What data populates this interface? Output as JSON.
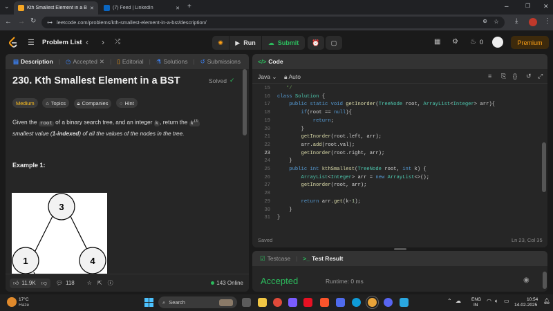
{
  "browser": {
    "tabs": [
      {
        "title": "Kth Smallest Element in a BST",
        "active": true
      },
      {
        "title": "(7) Feed | LinkedIn",
        "active": false
      }
    ],
    "url": "leetcode.com/problems/kth-smallest-element-in-a-bst/description/"
  },
  "nav": {
    "problem_list": "Problem List",
    "run": "Run",
    "submit": "Submit",
    "streak": "0",
    "premium": "Premium"
  },
  "desc_panel": {
    "tabs": [
      "Description",
      "Accepted",
      "Editorial",
      "Solutions",
      "Submissions"
    ],
    "title": "230. Kth Smallest Element in a BST",
    "solved": "Solved",
    "difficulty": "Medium",
    "chips": [
      "Topics",
      "Companies",
      "Hint"
    ],
    "statement": {
      "p1": "Given the ",
      "root": "root",
      "p2": " of a binary search tree, and an integer ",
      "k": "k",
      "p3": ", return the ",
      "kth": "k",
      "th": "th",
      "p4": "smallest value (",
      "bold": "1-indexed",
      "p5": ") of all the values of the nodes in the tree."
    },
    "example_heading": "Example 1:",
    "tree_nodes": [
      "3",
      "1",
      "4"
    ],
    "likes": "11.9K",
    "comments": "118",
    "online": "143 Online"
  },
  "code_panel": {
    "title": "Code",
    "language": "Java",
    "mode": "Auto",
    "status": "Saved",
    "cursor": "Ln 23, Col 35"
  },
  "code_lines": [
    {
      "n": "15",
      "segs": [
        [
          "cm",
          "   */"
        ]
      ]
    },
    {
      "n": "16",
      "segs": [
        [
          "kw",
          "class "
        ],
        [
          "ty",
          "Solution"
        ],
        [
          "pl",
          " {"
        ]
      ]
    },
    {
      "n": "17",
      "segs": [
        [
          "kw",
          "    public static void "
        ],
        [
          "fn",
          "getInorder"
        ],
        [
          "pl",
          "("
        ],
        [
          "ty",
          "TreeNode"
        ],
        [
          "pl",
          " root, "
        ],
        [
          "ty",
          "ArrayList"
        ],
        [
          "pl",
          "<"
        ],
        [
          "ty",
          "Integer"
        ],
        [
          "pl",
          "> arr){"
        ]
      ]
    },
    {
      "n": "18",
      "segs": [
        [
          "kw",
          "        if"
        ],
        [
          "pl",
          "(root == "
        ],
        [
          "kw",
          "null"
        ],
        [
          "pl",
          "){"
        ]
      ]
    },
    {
      "n": "19",
      "segs": [
        [
          "kw",
          "            return"
        ],
        [
          "pl",
          ";"
        ]
      ]
    },
    {
      "n": "20",
      "segs": [
        [
          "pl",
          "        }"
        ]
      ]
    },
    {
      "n": "21",
      "segs": [
        [
          "fn",
          "        getInorder"
        ],
        [
          "pl",
          "(root.left, arr);"
        ]
      ]
    },
    {
      "n": "22",
      "segs": [
        [
          "pl",
          "        arr."
        ],
        [
          "fn",
          "add"
        ],
        [
          "pl",
          "(root.val);"
        ]
      ]
    },
    {
      "n": "23",
      "segs": [
        [
          "fn",
          "        getInorder"
        ],
        [
          "pl",
          "(root.right, arr);"
        ]
      ]
    },
    {
      "n": "24",
      "segs": [
        [
          "pl",
          "    }"
        ]
      ]
    },
    {
      "n": "25",
      "segs": [
        [
          "kw",
          "    public int "
        ],
        [
          "fn",
          "kthSmallest"
        ],
        [
          "pl",
          "("
        ],
        [
          "ty",
          "TreeNode"
        ],
        [
          "pl",
          " root, "
        ],
        [
          "kw",
          "int"
        ],
        [
          "pl",
          " k) {"
        ]
      ]
    },
    {
      "n": "26",
      "segs": [
        [
          "ty",
          "        ArrayList"
        ],
        [
          "pl",
          "<"
        ],
        [
          "ty",
          "Integer"
        ],
        [
          "pl",
          "> arr = "
        ],
        [
          "kw",
          "new "
        ],
        [
          "ty",
          "ArrayList"
        ],
        [
          "pl",
          "<>();"
        ]
      ]
    },
    {
      "n": "27",
      "segs": [
        [
          "fn",
          "        getInorder"
        ],
        [
          "pl",
          "(root, arr);"
        ]
      ]
    },
    {
      "n": "28",
      "segs": [
        [
          "pl",
          ""
        ]
      ]
    },
    {
      "n": "29",
      "segs": [
        [
          "kw",
          "        return "
        ],
        [
          "pl",
          "arr."
        ],
        [
          "fn",
          "get"
        ],
        [
          "pl",
          "(k-"
        ],
        [
          "num",
          "1"
        ],
        [
          "pl",
          ");"
        ]
      ]
    },
    {
      "n": "30",
      "segs": [
        [
          "pl",
          "    }"
        ]
      ]
    },
    {
      "n": "31",
      "segs": [
        [
          "pl",
          "}"
        ]
      ]
    }
  ],
  "result_panel": {
    "tabs": [
      "Testcase",
      "Test Result"
    ],
    "verdict": "Accepted",
    "runtime": "Runtime: 0 ms"
  },
  "taskbar": {
    "weather_temp": "17°C",
    "weather_desc": "Haze",
    "search": "Search",
    "lang": "ENG",
    "region": "IN",
    "time": "10:54",
    "date": "14-02-2025"
  },
  "colors": {
    "accent_orange": "#ffa116",
    "accepted_green": "#2cbb5d",
    "submit_green": "#2cbb5d",
    "medium_yellow": "#ffc01e"
  }
}
